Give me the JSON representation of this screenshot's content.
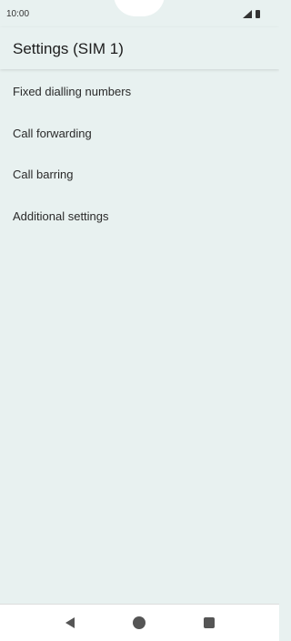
{
  "status_bar": {
    "time": "10:00",
    "icons": [
      "signal-icon",
      "battery-icon"
    ]
  },
  "header": {
    "title": "Settings (SIM 1)"
  },
  "settings": {
    "items": [
      {
        "label": "Fixed dialling numbers"
      },
      {
        "label": "Call forwarding"
      },
      {
        "label": "Call barring"
      },
      {
        "label": "Additional settings"
      }
    ]
  },
  "nav_bar": {
    "icons": [
      "back-icon",
      "home-icon",
      "recents-icon"
    ]
  }
}
